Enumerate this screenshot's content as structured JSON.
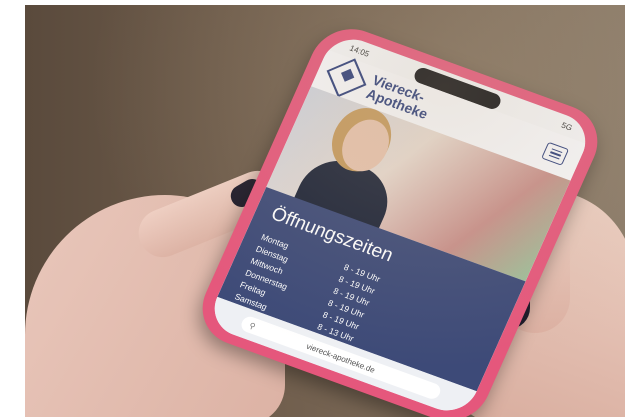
{
  "statusbar": {
    "time": "14:05",
    "indicators": "5G"
  },
  "header": {
    "brand_line1": "Viereck-",
    "brand_line2": "Apotheke"
  },
  "hours": {
    "title": "Öffnungszeiten",
    "rows": [
      {
        "day": "Montag",
        "time": "8 - 19 Uhr"
      },
      {
        "day": "Dienstag",
        "time": "8 - 19 Uhr"
      },
      {
        "day": "Mittwoch",
        "time": "8 - 19 Uhr"
      },
      {
        "day": "Donnerstag",
        "time": "8 - 19 Uhr"
      },
      {
        "day": "Freitag",
        "time": "8 - 19 Uhr"
      },
      {
        "day": "Samstag",
        "time": "8 - 13 Uhr"
      }
    ]
  },
  "urlbar": {
    "url": "viereck-apotheke.de"
  },
  "colors": {
    "phone_case": "#e5577c",
    "brand_blue": "#2e3f7c",
    "hours_bg": "#3d4a78"
  }
}
